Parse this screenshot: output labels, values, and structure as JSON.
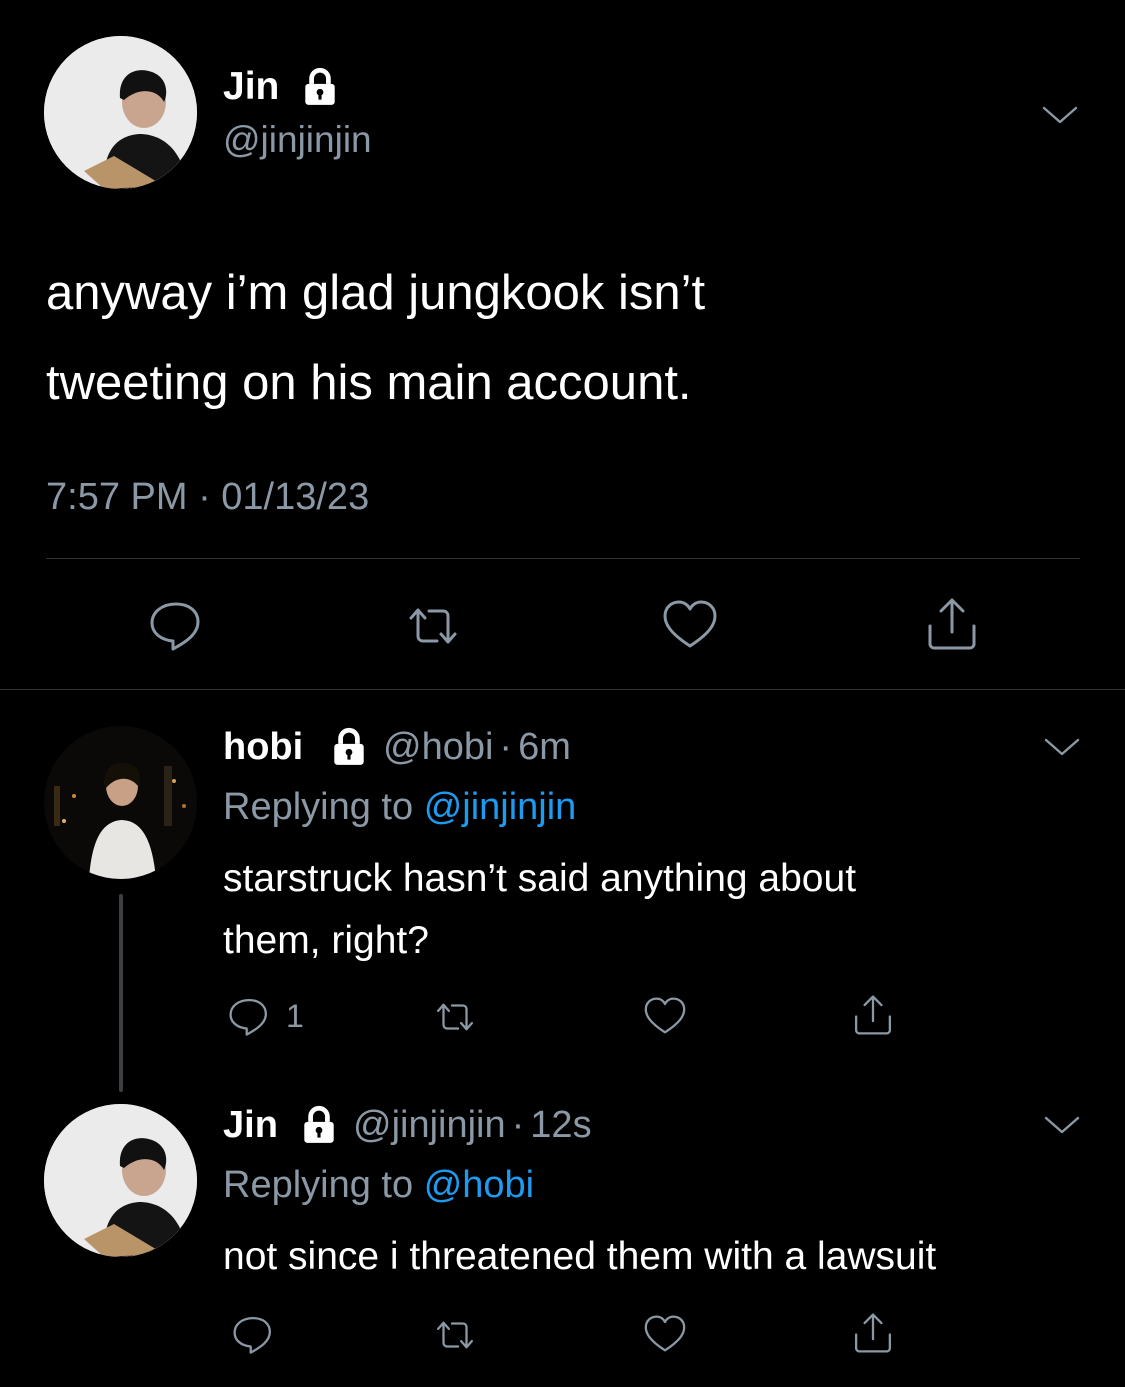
{
  "main_tweet": {
    "author_name": "Jin",
    "handle": "@jinjinjin",
    "text_line1": "anyway i’m glad jungkook isn’t",
    "text_line2": "tweeting on his main account.",
    "timestamp": "7:57 PM · 01/13/23"
  },
  "reply1": {
    "author_name": "hobi",
    "handle": "@hobi",
    "sep": "·",
    "time": "6m",
    "replying_label": "Replying to",
    "replying_to": "@jinjinjin",
    "text_line1": "starstruck hasn’t said anything about",
    "text_line2": "them, right?",
    "reply_count": "1"
  },
  "reply2": {
    "author_name": "Jin",
    "handle": "@jinjinjin",
    "sep": "·",
    "time": "12s",
    "replying_label": "Replying to",
    "replying_to": "@hobi",
    "text_line1": "not since i threatened them with a lawsuit"
  },
  "icons": {
    "lock": "lock-icon",
    "chevron": "chevron-down-icon",
    "reply": "reply-icon",
    "retweet": "retweet-icon",
    "like": "heart-icon",
    "share": "share-icon"
  },
  "colors": {
    "background": "#000000",
    "text": "#ffffff",
    "muted": "#8b98a5",
    "link": "#1d9bf0",
    "divider": "#2f3336"
  }
}
